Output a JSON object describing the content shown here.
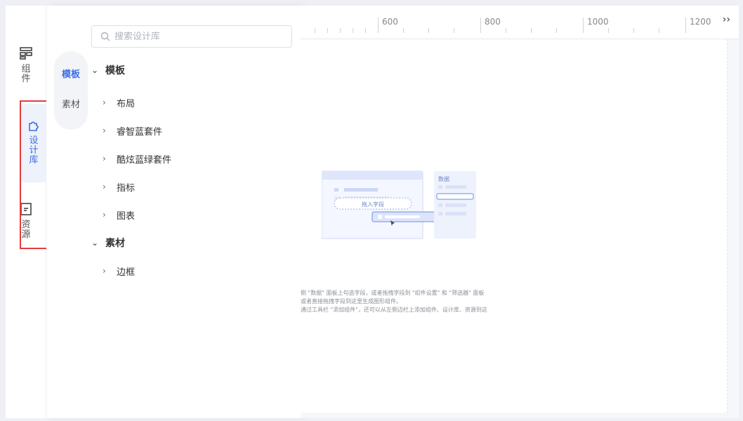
{
  "rail": {
    "items": [
      {
        "label": "组件",
        "icon": "components-icon"
      },
      {
        "label": "设计库",
        "icon": "puzzle-icon"
      },
      {
        "label": "资源",
        "icon": "document-icon"
      }
    ]
  },
  "subtabs": {
    "items": [
      "模板",
      "素材"
    ],
    "active": "模板"
  },
  "search": {
    "placeholder": "搜索设计库"
  },
  "tree": {
    "template_group": "模板",
    "template_children": [
      "布局",
      "睿智蓝套件",
      "酷炫蓝绿套件",
      "指标",
      "图表"
    ],
    "material_group": "素材",
    "material_children": [
      "边框"
    ]
  },
  "ruler": {
    "labels": [
      "600",
      "800",
      "1000",
      "1200"
    ]
  },
  "canvas": {
    "illustration": {
      "drop_label": "拖入字段",
      "data_panel_title": "数据"
    },
    "hint_lines": [
      "侧 \"数据\" 面板上勾选字段，或者拖拽字段到 \"组件设置\" 和 \"筛选器\" 面板",
      "或者直接拖拽字段到这里生成图形组件。",
      "通过工具栏 \"添加组件\"，还可以从左侧边栏上添加组件、设计库、资源到这"
    ]
  },
  "colors": {
    "accent": "#3d6ee8",
    "highlight": "#e53b3b"
  }
}
